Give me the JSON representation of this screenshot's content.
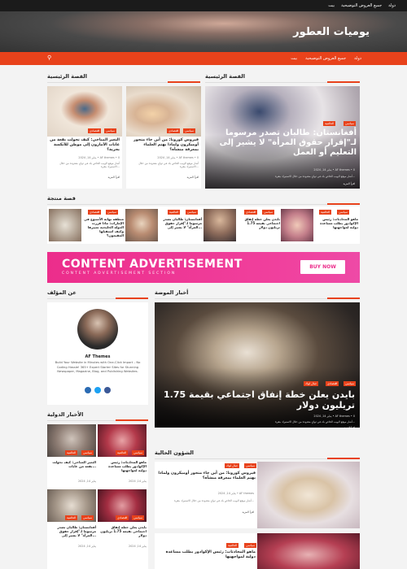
{
  "topbar": {
    "links": [
      "بيت",
      "جميع العروض التوضيحية",
      "دولة"
    ]
  },
  "site": {
    "title": "يوميات العطور"
  },
  "nav": {
    "items": [
      "بيت",
      "جميع العروض التوضيحية",
      "دولة"
    ]
  },
  "sections": {
    "main_story": "القصة الرئيسية",
    "main_stories": "القصة الرئيسية",
    "selected": "قصة منتجة",
    "latest": "أخبار الموضة",
    "author": "عن المؤلف",
    "international": "الأخبار الدولية",
    "current": "الشؤون الحالية"
  },
  "featured": {
    "tags": [
      "العالمية",
      "سياسي"
    ],
    "title": "أفغانستان: طالبان تصدر مرسوما لـ\"إقرار حقوق المرأة\" لا يشير إلى التعليم أو العمل",
    "meta_author": "AF themes",
    "meta_date": "يناير 14, 2024",
    "meta_comments": "0",
    "excerpt": "أشار موقع الويب الخاص بك في ثوانٍ معدودة من خلال الاستيراد بنقرة...",
    "more": "اقرأ المزيد"
  },
  "side_stories": [
    {
      "tags": [
        "اقتصادي",
        "سياسي"
      ],
      "title": "فيروس كورونا: من أين جاء متحور أوميكرون ولماذا يهتم العلماء بمعرفة منشأه؟",
      "author": "AF themes",
      "date": "يناير 14, 2024",
      "comments": "0",
      "excerpt": "أشار موقع الويب الخاص بك في ثوانٍ معدودة من خلال الاستيراد بنقرة...",
      "more": "اقرأ المزيد"
    },
    {
      "tags": [
        "اقتصادي",
        "سياسي"
      ],
      "title": "التغير المناخي: كيف تحولت بقعة من غابات الأمازون إلى موطن للأنكسة بحرية؟",
      "author": "AF themes",
      "date": "يناير 14, 2024",
      "comments": "0",
      "excerpt": "أشار موقع الويب الخاص بك في ثوانٍ معدودة من خلال الاستيراد بنقرة...",
      "more": "اقرأ المزيد"
    }
  ],
  "selected_stories": [
    {
      "tags": [
        "العالمية",
        "سياسي"
      ],
      "title": "ماهو المحادثات: رئيس الإكوادور يطلب مساعدة دولية لمواجهتها"
    },
    {
      "tags": [
        "اقتصادي",
        "سياسي",
        "جبال لوك"
      ],
      "title": "بايدن يعلن خطة إنفاق اجتماعي بقيمة 1.75 تريليون دولار"
    },
    {
      "tags": [
        "العالمية",
        "سياسي"
      ],
      "title": "أفغانستان: طالبان تصدر مرسوما لـ\"إقرار حقوق المرأة\" لا يشير إلى..."
    },
    {
      "tags": [
        "اقتصادي",
        "سياسي"
      ],
      "title": "منطقة نهاية الأسبوع في الإمارات: ماذا قررت الدولة الخليجية تغييرها وكيف استقبلها المقيمون؟"
    }
  ],
  "advert": {
    "headline": "CONTENT ADVERTISEMENT",
    "sub": "CONTENT ADVERTISEMENT SECTION",
    "button": "BUY NOW"
  },
  "fashion": {
    "tags": [
      "اقتصادي",
      "سياسي",
      "جبال لوك"
    ],
    "title": "بايدن يعلن خطة إنفاق اجتماعي بقيمة 1.75 تريليون دولار",
    "author": "AF themes",
    "date": "يناير 14, 2024",
    "comments": "0",
    "excerpt": "أشار موقع الويب الخاص بك في ثوانٍ معدودة من خلال الاستيراد بنقرة...",
    "more": "اقرأ المزيد"
  },
  "author_box": {
    "name": "AF Themes",
    "bio": "Build Your Website in Minutes with One-Click Import – No Coding Hassle! 365+ Expert Starter Sites for Stunning Newspaper, Magazine, Blog, and Publishing Websites."
  },
  "intl": [
    {
      "tags": [
        "العالمية",
        "سياسي"
      ],
      "title": "ماهو المحادثات: رئيس الإكوادور يطلب مساعدة دولية لمواجهتها",
      "date": "يناير 14, 2024"
    },
    {
      "tags": [
        "العالمية",
        "سياسي"
      ],
      "title": "التغير المناخي: كيف تحولت بقعة من غابات...",
      "date": "يناير 14, 2024"
    },
    {
      "tags": [
        "اقتصادي",
        "سياسي"
      ],
      "title": "بايدن يعلن خطة إنفاق اجتماعي بقيمة 1.75 تريليون دولار",
      "date": "يناير 14, 2024"
    },
    {
      "tags": [
        "العالمية",
        "سياسي"
      ],
      "title": "أفغانستان: طالبان تصدر مرسوما لـ\"إقرار حقوق المرأة\" لا يشير إلى...",
      "date": "يناير 14, 2024"
    }
  ],
  "current": [
    {
      "tags": [
        "سياسي",
        "جبال لوك"
      ],
      "title": "فيروس كورونا: من أين جاء متحور أوميكرون ولماذا يهتم العلماء بمعرفة منشأه؟",
      "author": "AF themes",
      "date": "يناير 14, 2024",
      "excerpt": "أشار موقع الويب الخاص بك في ثوانٍ معدودة من خلال الاستيراد بنقرة...",
      "more": "اقرأ المزيد"
    },
    {
      "tags": [
        "العالمية",
        "سياسي"
      ],
      "title": "ماهو المحادثات: رئيس الإكوادور يطلب مساعدة دولية لمواجهتها"
    }
  ]
}
